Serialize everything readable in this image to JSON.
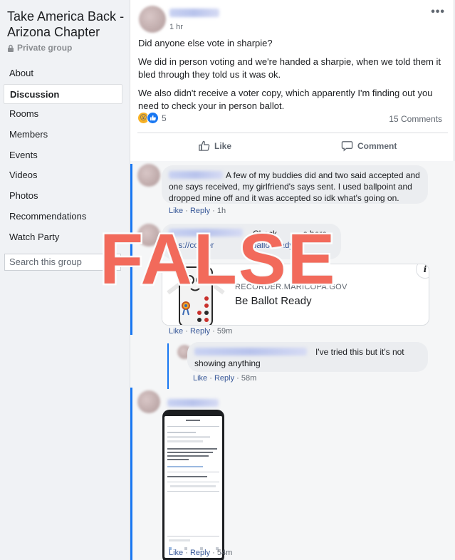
{
  "sidebar": {
    "group_title": "Take America Back - Arizona Chapter",
    "privacy": "Private group",
    "items": [
      {
        "label": "About"
      },
      {
        "label": "Discussion"
      },
      {
        "label": "Rooms"
      },
      {
        "label": "Members"
      },
      {
        "label": "Events"
      },
      {
        "label": "Videos"
      },
      {
        "label": "Photos"
      },
      {
        "label": "Recommendations"
      },
      {
        "label": "Watch Party"
      }
    ],
    "search_placeholder": "Search this group"
  },
  "post": {
    "time": "1 hr",
    "more": "•••",
    "paragraphs": [
      "Did anyone else vote in sharpie?",
      "We did in person voting and we're handed a sharpie, when we told them it bled through they told us it was ok.",
      "We also didn't receive a voter copy, which apparently I'm finding out you need to check your in person ballot."
    ],
    "reaction_count": "5",
    "comment_count": "15 Comments",
    "actions": {
      "like": "Like",
      "comment": "Comment"
    }
  },
  "comments": [
    {
      "text": "A few of my buddies did and two said accepted and one says received, my girlfriend's says sent. I used ballpoint and dropped mine off and it was accepted so idk what's going on.",
      "like": "Like",
      "reply": "Reply",
      "time": "1h"
    },
    {
      "text_visible": "Check",
      "text_tail": "s here",
      "link_start": "ttps://",
      "link_mid": "corder",
      "link_end": "ballotready/",
      "card": {
        "domain": "RECORDER.MARICOPA.GOV",
        "title": "Be Ballot Ready",
        "info": "i"
      },
      "like": "Like",
      "reply": "Reply",
      "time": "59m"
    },
    {
      "text": "I've tried this but it's not showing anything",
      "like": "Like",
      "reply": "Reply",
      "time": "58m"
    },
    {
      "like": "Like",
      "reply": "Reply",
      "time": "54m"
    }
  ],
  "overlay": {
    "stamp": "FALSE"
  },
  "colors": {
    "accent": "#1877f2",
    "stamp": "#f26a5b",
    "link": "#385898"
  }
}
